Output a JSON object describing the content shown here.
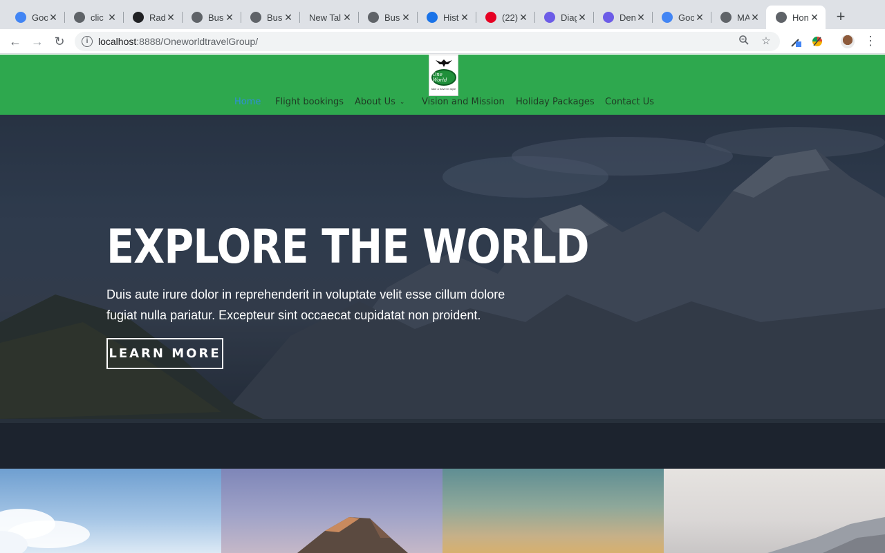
{
  "browser": {
    "tabs": [
      {
        "title": "Goo",
        "icon": "google-icon",
        "color": "#4285f4"
      },
      {
        "title": "clic",
        "icon": "globe-icon",
        "color": "#5f6368"
      },
      {
        "title": "Radi",
        "icon": "radix-icon",
        "color": "#202124"
      },
      {
        "title": "Bus",
        "icon": "globe-icon",
        "color": "#5f6368"
      },
      {
        "title": "Bus",
        "icon": "globe-icon",
        "color": "#5f6368"
      },
      {
        "title": "New Tal",
        "icon": "",
        "color": ""
      },
      {
        "title": "Bus",
        "icon": "globe-icon",
        "color": "#5f6368"
      },
      {
        "title": "Hist",
        "icon": "history-icon",
        "color": "#1a73e8"
      },
      {
        "title": "(22)",
        "icon": "pinterest-icon",
        "color": "#e60023"
      },
      {
        "title": "Diag",
        "icon": "diagram-app-icon",
        "color": "#6c5ce7"
      },
      {
        "title": "Den",
        "icon": "diagram-app-icon",
        "color": "#6c5ce7"
      },
      {
        "title": "Goo",
        "icon": "google-icon",
        "color": "#4285f4"
      },
      {
        "title": "MA",
        "icon": "github-icon",
        "color": "#5f6368"
      },
      {
        "title": "Hon",
        "icon": "github-icon",
        "color": "#5f6368"
      }
    ],
    "active_tab": 13,
    "url_host": "localhost",
    "url_rest": ":8888/OneworldtravelGroup/"
  },
  "site": {
    "logo_text": "One World",
    "logo_tagline": "take a travel in style",
    "brand_color": "#2ea84e",
    "nav": [
      {
        "label": "Home",
        "current": true
      },
      {
        "label": "Flight bookings"
      },
      {
        "label": "About Us",
        "has_dropdown": true
      },
      {
        "label": "Vision and Mission"
      },
      {
        "label": "Holiday Packages"
      },
      {
        "label": "Contact Us"
      }
    ]
  },
  "hero": {
    "title": "EXPLORE THE WORLD",
    "text": "Duis aute irure dolor in reprehenderit in voluptate velit esse cillum dolore fugiat nulla pariatur. Excepteur sint occaecat cupidatat non proident.",
    "button_label": "LEARN MORE"
  }
}
